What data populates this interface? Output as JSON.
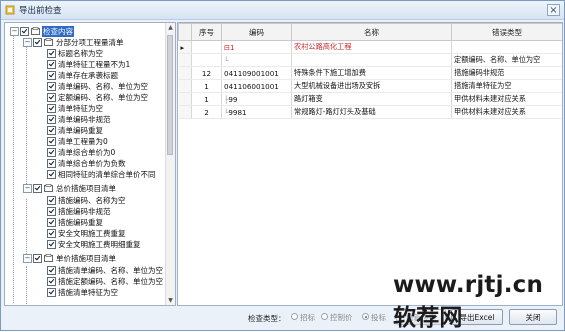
{
  "window": {
    "title": "导出前检查"
  },
  "tree": {
    "root": "检查内容",
    "groups": [
      {
        "label": "分部分项工程量清单",
        "items": [
          "标题名称为空",
          "清单特征工程量不为1",
          "清单存在承袭标题",
          "清单编码、名称、单位为空",
          "定额编码、名称、单位为空",
          "清单特征为空",
          "清单编码非规范",
          "清单编码重复",
          "清单工程量为0",
          "清单综合单价为0",
          "清单综合单价为负数",
          "相同特征的清单综合单价不同"
        ]
      },
      {
        "label": "总价措施项目清单",
        "items": [
          "措施编码、名称为空",
          "措施编码非规范",
          "措施编码重复",
          "安全文明施工费重复",
          "安全文明施工费明细重复"
        ]
      },
      {
        "label": "单价措施项目清单",
        "items": [
          "措施清单编码、名称、单位为空",
          "措施定额编码、名称、单位为空",
          "措施清单特征为空"
        ]
      }
    ]
  },
  "grid": {
    "columns": [
      "序号",
      "编码",
      "名称",
      "错误类型"
    ],
    "rows": [
      {
        "seq": "",
        "code": "1",
        "name": "农村公路高化工程",
        "error": ""
      },
      {
        "seq": "",
        "code": "",
        "name": "",
        "error": "定额编码、名称、单位为空"
      },
      {
        "seq": "12",
        "code": "041109001001",
        "name": "特殊条件下施工增加费",
        "error": "措施编码非规范"
      },
      {
        "seq": "1",
        "code": "041106001001",
        "name": "大型机械设备进出场及安拆",
        "error": "措施清单特征为空"
      },
      {
        "seq": "1",
        "code": "99",
        "name": "路灯箱变",
        "error": "甲供材料未建对应关系"
      },
      {
        "seq": "2",
        "code": "9981",
        "name": "常规路灯-路灯灯头及基础",
        "error": "甲供材料未建对应关系"
      }
    ]
  },
  "bottom": {
    "check_type_label": "检查类型：",
    "radio_options": [
      "招标",
      "控制价",
      "投标"
    ],
    "recheck_label": "重新检查",
    "export_label": "导出Excel",
    "close_label": "关闭"
  },
  "watermark": "www.rjtj.cn软荐网"
}
